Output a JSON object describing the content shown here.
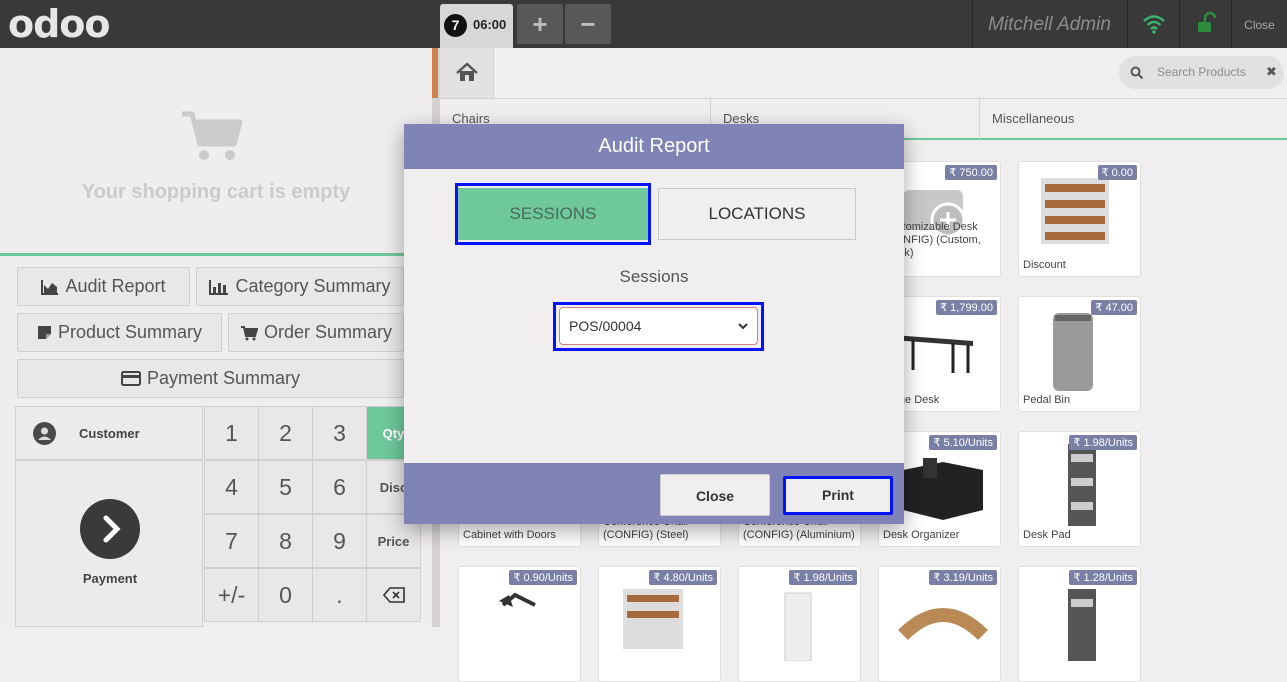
{
  "topbar": {
    "logo": "odoo",
    "order": {
      "number": "7",
      "time": "06:00"
    },
    "add_label": "+",
    "remove_label": "−",
    "user": "Mitchell Admin",
    "close_label": "Close"
  },
  "cart": {
    "empty_text": "Your shopping cart is empty"
  },
  "reports": {
    "audit": "Audit Report",
    "category": "Category Summary",
    "product": "Product Summary",
    "order": "Order Summary",
    "payment": "Payment Summary"
  },
  "numpad": {
    "customer": "Customer",
    "payment": "Payment",
    "keys": [
      "1",
      "2",
      "3",
      "4",
      "5",
      "6",
      "7",
      "8",
      "9",
      "+/-",
      "0",
      "."
    ],
    "modes": {
      "qty": "Qty",
      "disc": "Disc",
      "price": "Price"
    }
  },
  "search": {
    "placeholder": "Search Products"
  },
  "categories": [
    "Chairs",
    "Desks",
    "Miscellaneous"
  ],
  "products": [
    {
      "price": "₹ 750.00",
      "name": "Customizable Desk (CONFIG) (Custom, Black)"
    },
    {
      "price": "₹ 0.00",
      "name": "Discount"
    },
    {
      "price": "₹ 1,799.00",
      "name": "Large Desk"
    },
    {
      "price": "₹ 47.00",
      "name": "Pedal Bin"
    },
    {
      "price": "",
      "name": "Cabinet with Doors"
    },
    {
      "price": "",
      "name": "Conference Chair (CONFIG) (Steel)"
    },
    {
      "price": "",
      "name": "Conference Chair (CONFIG) (Aluminium)"
    },
    {
      "price": "₹ 5.10/Units",
      "name": "Desk Organizer"
    },
    {
      "price": "₹ 1.98/Units",
      "name": "Desk Pad"
    },
    {
      "price": "₹ 0.90/Units",
      "name": ""
    },
    {
      "price": "₹ 4.80/Units",
      "name": ""
    },
    {
      "price": "₹ 1.98/Units",
      "name": ""
    },
    {
      "price": "₹ 3.19/Units",
      "name": ""
    },
    {
      "price": "₹ 1.28/Units",
      "name": ""
    }
  ],
  "modal": {
    "title": "Audit Report",
    "tab_sessions": "SESSIONS",
    "tab_locations": "LOCATIONS",
    "sessions_label": "Sessions",
    "selected_session": "POS/00004",
    "close_label": "Close",
    "print_label": "Print"
  },
  "colors": {
    "accent": "#6ec89b",
    "modal_header": "#7f83b5",
    "highlight": "#0013ff"
  }
}
